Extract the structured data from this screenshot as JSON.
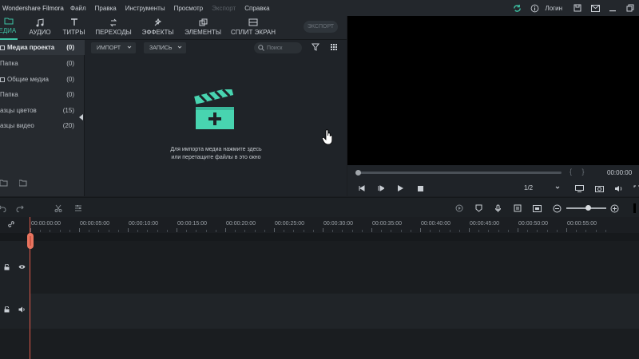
{
  "app": {
    "title": "Wondershare Filmora",
    "menu": [
      {
        "label": "Файл",
        "disabled": false
      },
      {
        "label": "Правка",
        "disabled": false
      },
      {
        "label": "Инструменты",
        "disabled": false
      },
      {
        "label": "Просмотр",
        "disabled": false
      },
      {
        "label": "Экспорт",
        "disabled": true
      },
      {
        "label": "Справка",
        "disabled": false
      }
    ],
    "login_label": "Логин"
  },
  "media": {
    "tabs": [
      {
        "label": "МЕДИА",
        "icon": "folder-icon",
        "active": true
      },
      {
        "label": "АУДИО",
        "icon": "music-note-icon",
        "active": false
      },
      {
        "label": "ТИТРЫ",
        "icon": "text-icon",
        "active": false
      },
      {
        "label": "ПЕРЕХОДЫ",
        "icon": "transition-icon",
        "active": false
      },
      {
        "label": "ЭФФЕКТЫ",
        "icon": "effects-icon",
        "active": false
      },
      {
        "label": "ЭЛЕМЕНТЫ",
        "icon": "elements-icon",
        "active": false
      },
      {
        "label": "СПЛИТ ЭКРАН",
        "icon": "split-screen-icon",
        "active": false
      }
    ],
    "export_label": "ЭКСПОРТ",
    "sidebar": [
      {
        "label": "Медиа проекта",
        "count": "(0)",
        "active": true
      },
      {
        "label": "Папка",
        "count": "(0)",
        "active": false
      },
      {
        "label": "Общие медиа",
        "count": "(0)",
        "active": false
      },
      {
        "label": "Папка",
        "count": "(0)",
        "active": false
      },
      {
        "label": "азцы цветов",
        "count": "(15)",
        "active": false
      },
      {
        "label": "азцы видео",
        "count": "(20)",
        "active": false
      }
    ],
    "import_label": "ИМПОРТ",
    "record_label": "ЗАПИСЬ",
    "search_placeholder": "Поиск",
    "drop_text_line1": "Для импорта медиа нажмите здесь",
    "drop_text_line2": "или перетащите файлы в это окно"
  },
  "preview": {
    "timecode": "00:00:00",
    "ratio": "1/2",
    "progress": 0
  },
  "timeline": {
    "ruler_labels": [
      "00:00:00:00",
      "00:00:05:00",
      "00:00:10:00",
      "00:00:15:00",
      "00:00:20:00",
      "00:00:25:00",
      "00:00:30:00",
      "00:00:35:00",
      "00:00:40:00",
      "00:00:45:00",
      "00:00:50:00",
      "00:00:55:00"
    ],
    "zoom_level": 0.55
  }
}
